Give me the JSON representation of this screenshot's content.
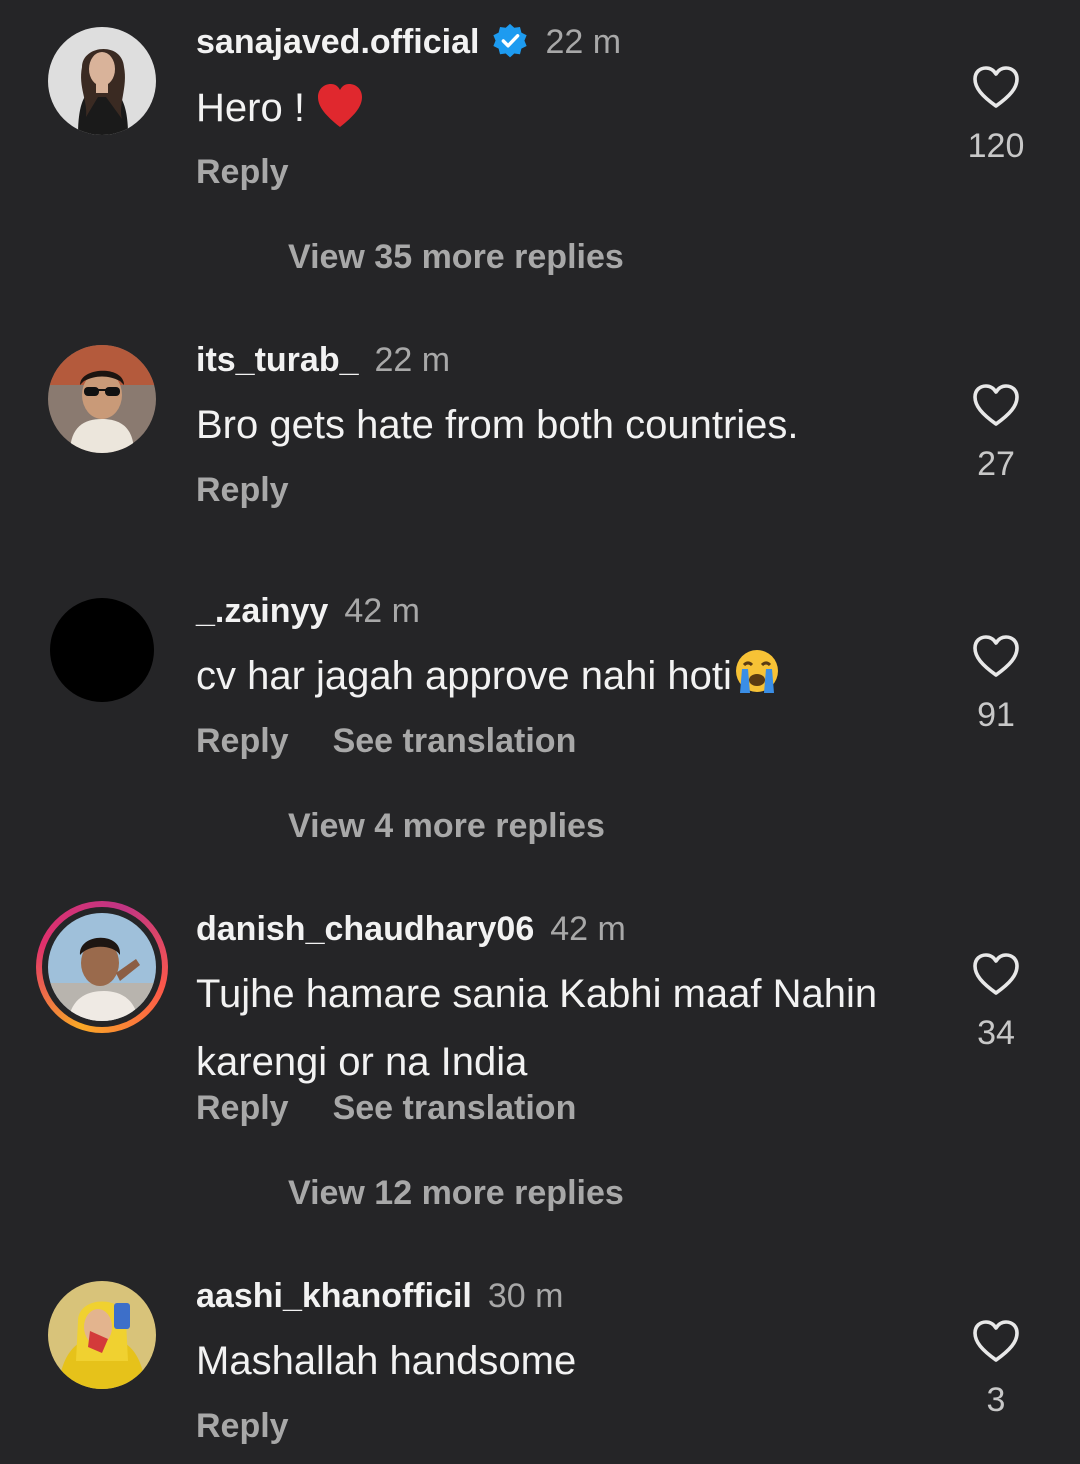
{
  "comments": [
    {
      "username": "sanajaved.official",
      "verified": true,
      "time": "22 m",
      "text": "Hero ! ",
      "emoji": "red-heart",
      "reply_label": "Reply",
      "translation_label": "",
      "likes": "120",
      "more_replies": "View 35 more replies"
    },
    {
      "username": "its_turab_",
      "verified": false,
      "time": "22 m",
      "text": "Bro gets hate from both countries.",
      "reply_label": "Reply",
      "likes": "27"
    },
    {
      "username": "_.zainyy",
      "verified": false,
      "time": "42 m",
      "text": "cv har jagah approve nahi hoti",
      "emoji": "crying-face",
      "reply_label": "Reply",
      "translation_label": "See translation",
      "likes": "91",
      "more_replies": "View 4 more replies"
    },
    {
      "username": "danish_chaudhary06",
      "verified": false,
      "has_story": true,
      "time": "42 m",
      "text": "Tujhe hamare sania  Kabhi maaf Nahin karengi or na India",
      "reply_label": "Reply",
      "translation_label": "See translation",
      "likes": "34",
      "more_replies": "View 12 more replies"
    },
    {
      "username": "aashi_khanofficil",
      "verified": false,
      "time": "30 m",
      "text": "Mashallah handsome",
      "reply_label": "Reply",
      "likes": "3"
    }
  ],
  "colors": {
    "background": "#252527",
    "primary_text": "#f2f2f2",
    "secondary_text": "#a8a8a8",
    "verified_blue": "#1d9bf0",
    "heart_red": "#e0282e"
  },
  "icons": {
    "like": "heart-outline-icon",
    "verified": "verified-badge-icon"
  }
}
